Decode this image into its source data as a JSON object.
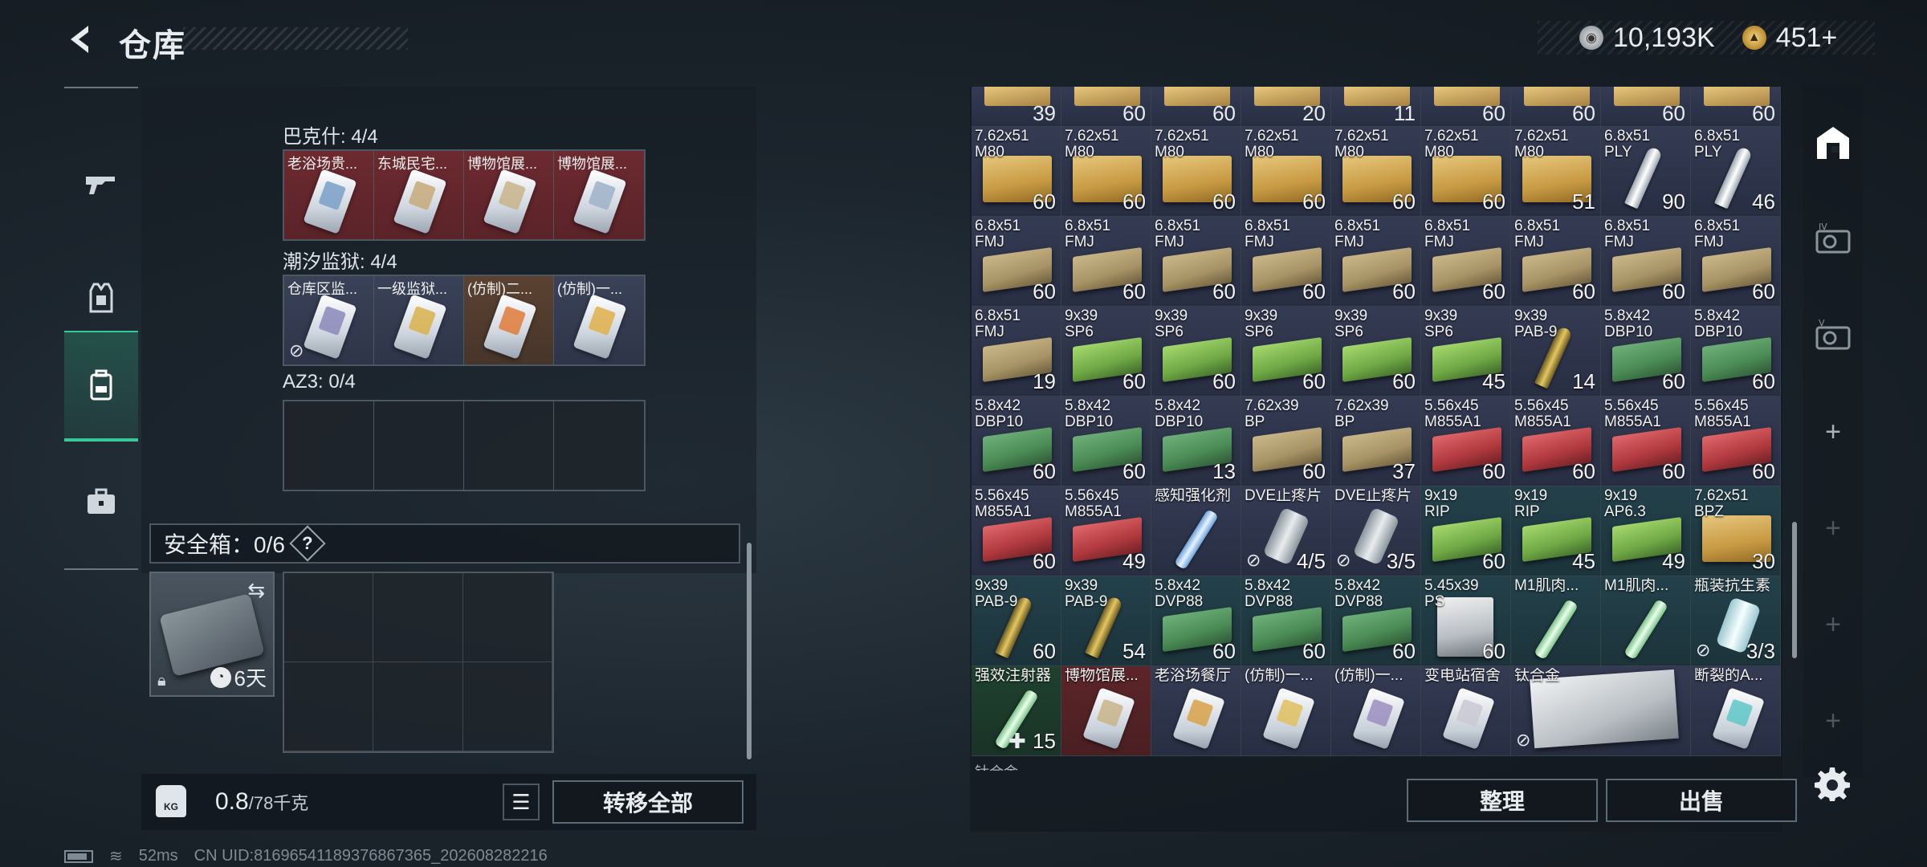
{
  "header": {
    "title": "仓库",
    "currency": [
      {
        "icon": "silver-coin-icon",
        "value": "10,193K"
      },
      {
        "icon": "gold-coin-icon",
        "value": "451+"
      }
    ]
  },
  "nav": [
    {
      "name": "weapons",
      "icon": "gun-icon"
    },
    {
      "name": "equipment",
      "icon": "armor-vest-icon"
    },
    {
      "name": "storage",
      "icon": "backpack-icon",
      "active": true
    },
    {
      "name": "keys",
      "icon": "briefcase-icon"
    }
  ],
  "key_categories": [
    {
      "label": "巴克什: 4/4",
      "slots": [
        {
          "name": "老浴场贵...",
          "quality": "red",
          "card_color": "#7aa0c8"
        },
        {
          "name": "东城民宅...",
          "quality": "red",
          "card_color": "#c7a97a"
        },
        {
          "name": "博物馆展...",
          "quality": "red",
          "card_color": "#c8b48a"
        },
        {
          "name": "博物馆展...",
          "quality": "red",
          "card_color": "#9fb2c8"
        }
      ]
    },
    {
      "label": "潮汐监狱: 4/4",
      "slots": [
        {
          "name": "仓库区监...",
          "quality": "blue",
          "card_color": "#8a88b8",
          "no_loss": true
        },
        {
          "name": "一级监狱...",
          "quality": "blue",
          "card_color": "#d8b24a"
        },
        {
          "name": "(仿制)二...",
          "quality": "orange",
          "card_color": "#e07a3a"
        },
        {
          "name": "(仿制)一...",
          "quality": "blue",
          "card_color": "#e0b04a"
        }
      ]
    },
    {
      "label": "AZ3: 0/4",
      "slots": [
        {},
        {},
        {},
        {}
      ]
    }
  ],
  "safe_box": {
    "label": "安全箱：0/6",
    "help": "?",
    "duration": "6天"
  },
  "weight": {
    "kg_label": "KG",
    "current": "0.8",
    "max": "/78千克"
  },
  "buttons": {
    "transfer_all": "转移全部",
    "sort": "整理",
    "sell": "出售"
  },
  "status": {
    "ping": "52ms",
    "uid": "CN UID:8169654118937686736​5_202608282216"
  },
  "partial_row_counts": [
    "39",
    "60",
    "60",
    "20",
    "11",
    "60",
    "60",
    "60",
    "60"
  ],
  "inventory": [
    {
      "name": "7.62x51\nM80",
      "count": "60",
      "q": "blue",
      "img": "box tan"
    },
    {
      "name": "7.62x51\nM80",
      "count": "60",
      "q": "blue",
      "img": "box tan"
    },
    {
      "name": "7.62x51\nM80",
      "count": "60",
      "q": "blue",
      "img": "box tan"
    },
    {
      "name": "7.62x51\nM80",
      "count": "60",
      "q": "blue",
      "img": "box tan"
    },
    {
      "name": "7.62x51\nM80",
      "count": "60",
      "q": "blue",
      "img": "box tan"
    },
    {
      "name": "7.62x51\nM80",
      "count": "60",
      "q": "blue",
      "img": "box tan"
    },
    {
      "name": "7.62x51\nM80",
      "count": "51",
      "q": "blue",
      "img": "box tan"
    },
    {
      "name": "6.8x51\nPLY",
      "count": "90",
      "q": "blue",
      "img": "bullet white"
    },
    {
      "name": "6.8x51\nPLY",
      "count": "46",
      "q": "blue",
      "img": "bullet white"
    },
    {
      "name": "6.8x51\nFMJ",
      "count": "60",
      "q": "blue",
      "img": "box khaki"
    },
    {
      "name": "6.8x51\nFMJ",
      "count": "60",
      "q": "blue",
      "img": "box khaki"
    },
    {
      "name": "6.8x51\nFMJ",
      "count": "60",
      "q": "blue",
      "img": "box khaki"
    },
    {
      "name": "6.8x51\nFMJ",
      "count": "60",
      "q": "blue",
      "img": "box khaki"
    },
    {
      "name": "6.8x51\nFMJ",
      "count": "60",
      "q": "blue",
      "img": "box khaki"
    },
    {
      "name": "6.8x51\nFMJ",
      "count": "60",
      "q": "blue",
      "img": "box khaki"
    },
    {
      "name": "6.8x51\nFMJ",
      "count": "60",
      "q": "blue",
      "img": "box khaki"
    },
    {
      "name": "6.8x51\nFMJ",
      "count": "60",
      "q": "blue",
      "img": "box khaki"
    },
    {
      "name": "6.8x51\nFMJ",
      "count": "60",
      "q": "blue",
      "img": "box khaki"
    },
    {
      "name": "6.8x51\nFMJ",
      "count": "19",
      "q": "blue",
      "img": "box khaki"
    },
    {
      "name": "9x39\nSP6",
      "count": "60",
      "q": "blue",
      "img": "box green"
    },
    {
      "name": "9x39\nSP6",
      "count": "60",
      "q": "blue",
      "img": "box green"
    },
    {
      "name": "9x39\nSP6",
      "count": "60",
      "q": "blue",
      "img": "box green"
    },
    {
      "name": "9x39\nSP6",
      "count": "60",
      "q": "blue",
      "img": "box green"
    },
    {
      "name": "9x39\nSP6",
      "count": "45",
      "q": "blue",
      "img": "box green"
    },
    {
      "name": "9x39\nPAB-9",
      "count": "14",
      "q": "blue",
      "img": "bullet"
    },
    {
      "name": "5.8x42\nDBP10",
      "count": "60",
      "q": "blue",
      "img": "box dgreen"
    },
    {
      "name": "5.8x42\nDBP10",
      "count": "60",
      "q": "blue",
      "img": "box dgreen"
    },
    {
      "name": "5.8x42\nDBP10",
      "count": "60",
      "q": "blue",
      "img": "box dgreen"
    },
    {
      "name": "5.8x42\nDBP10",
      "count": "60",
      "q": "blue",
      "img": "box dgreen"
    },
    {
      "name": "5.8x42\nDBP10",
      "count": "13",
      "q": "blue",
      "img": "box dgreen"
    },
    {
      "name": "7.62x39\nBP",
      "count": "60",
      "q": "blue",
      "img": "box khaki"
    },
    {
      "name": "7.62x39\nBP",
      "count": "37",
      "q": "blue",
      "img": "box khaki"
    },
    {
      "name": "5.56x45\nM855A1",
      "count": "60",
      "q": "blue",
      "img": "box red"
    },
    {
      "name": "5.56x45\nM855A1",
      "count": "60",
      "q": "blue",
      "img": "box red"
    },
    {
      "name": "5.56x45\nM855A1",
      "count": "60",
      "q": "blue",
      "img": "box red"
    },
    {
      "name": "5.56x45\nM855A1",
      "count": "60",
      "q": "blue",
      "img": "box red"
    },
    {
      "name": "5.56x45\nM855A1",
      "count": "60",
      "q": "blue",
      "img": "box red"
    },
    {
      "name": "5.56x45\nM855A1",
      "count": "49",
      "q": "blue",
      "img": "box red"
    },
    {
      "name": "感知强化剂",
      "count": "",
      "q": "blue",
      "img": "syringe"
    },
    {
      "name": "DVE止疼片",
      "count": "4/5",
      "q": "blue",
      "img": "tube",
      "no_loss": true
    },
    {
      "name": "DVE止疼片",
      "count": "3/5",
      "q": "blue",
      "img": "tube",
      "no_loss": true
    },
    {
      "name": "9x19\nRIP",
      "count": "60",
      "q": "teal",
      "img": "box green"
    },
    {
      "name": "9x19\nRIP",
      "count": "45",
      "q": "teal",
      "img": "box green"
    },
    {
      "name": "9x19\nAP6.3",
      "count": "49",
      "q": "teal",
      "img": "box green"
    },
    {
      "name": "7.62x51\nBPZ",
      "count": "30",
      "q": "teal",
      "img": "box tan"
    },
    {
      "name": "9x39\nPAB-9",
      "count": "60",
      "q": "teal",
      "img": "bullet"
    },
    {
      "name": "9x39\nPAB-9",
      "count": "54",
      "q": "teal",
      "img": "bullet"
    },
    {
      "name": "5.8x42\nDVP88",
      "count": "60",
      "q": "teal",
      "img": "box dgreen"
    },
    {
      "name": "5.8x42\nDVP88",
      "count": "60",
      "q": "teal",
      "img": "box dgreen"
    },
    {
      "name": "5.8x42\nDVP88",
      "count": "60",
      "q": "teal",
      "img": "box dgreen"
    },
    {
      "name": "5.45x39\nPS",
      "count": "60",
      "q": "teal",
      "img": "box silver"
    },
    {
      "name": "M1肌肉...",
      "count": "",
      "q": "teal",
      "img": "syringe green"
    },
    {
      "name": "M1肌肉...",
      "count": "",
      "q": "teal",
      "img": "syringe green"
    },
    {
      "name": "瓶装抗生素",
      "count": "3/3",
      "q": "teal",
      "img": "vial",
      "no_loss": true
    },
    {
      "name": "强效注射器",
      "count": "15",
      "q": "green",
      "img": "syringe green",
      "plus": true
    },
    {
      "name": "博物馆展...",
      "count": "",
      "q": "red",
      "img": "card-ic",
      "card_color": "#c8b48a"
    },
    {
      "name": "老浴场餐厅",
      "count": "",
      "q": "blue",
      "img": "card-ic",
      "card_color": "#d8a24a"
    },
    {
      "name": "(仿制)一...",
      "count": "",
      "q": "blue",
      "img": "card-ic",
      "card_color": "#e0c060"
    },
    {
      "name": "(仿制)一...",
      "count": "",
      "q": "blue",
      "img": "card-ic",
      "card_color": "#9b8ec0"
    },
    {
      "name": "变电站宿舍",
      "count": "",
      "q": "blue",
      "img": "card-ic",
      "card_color": "#c9c9d4"
    },
    {
      "name": "钛合金",
      "count": "",
      "q": "blue",
      "img": "plate",
      "wide": true,
      "no_loss": true
    },
    {
      "name": "断裂的A...",
      "count": "",
      "q": "blue",
      "img": "card-ic",
      "card_color": "#5fc7c7"
    }
  ],
  "cut_label": "钛合金"
}
